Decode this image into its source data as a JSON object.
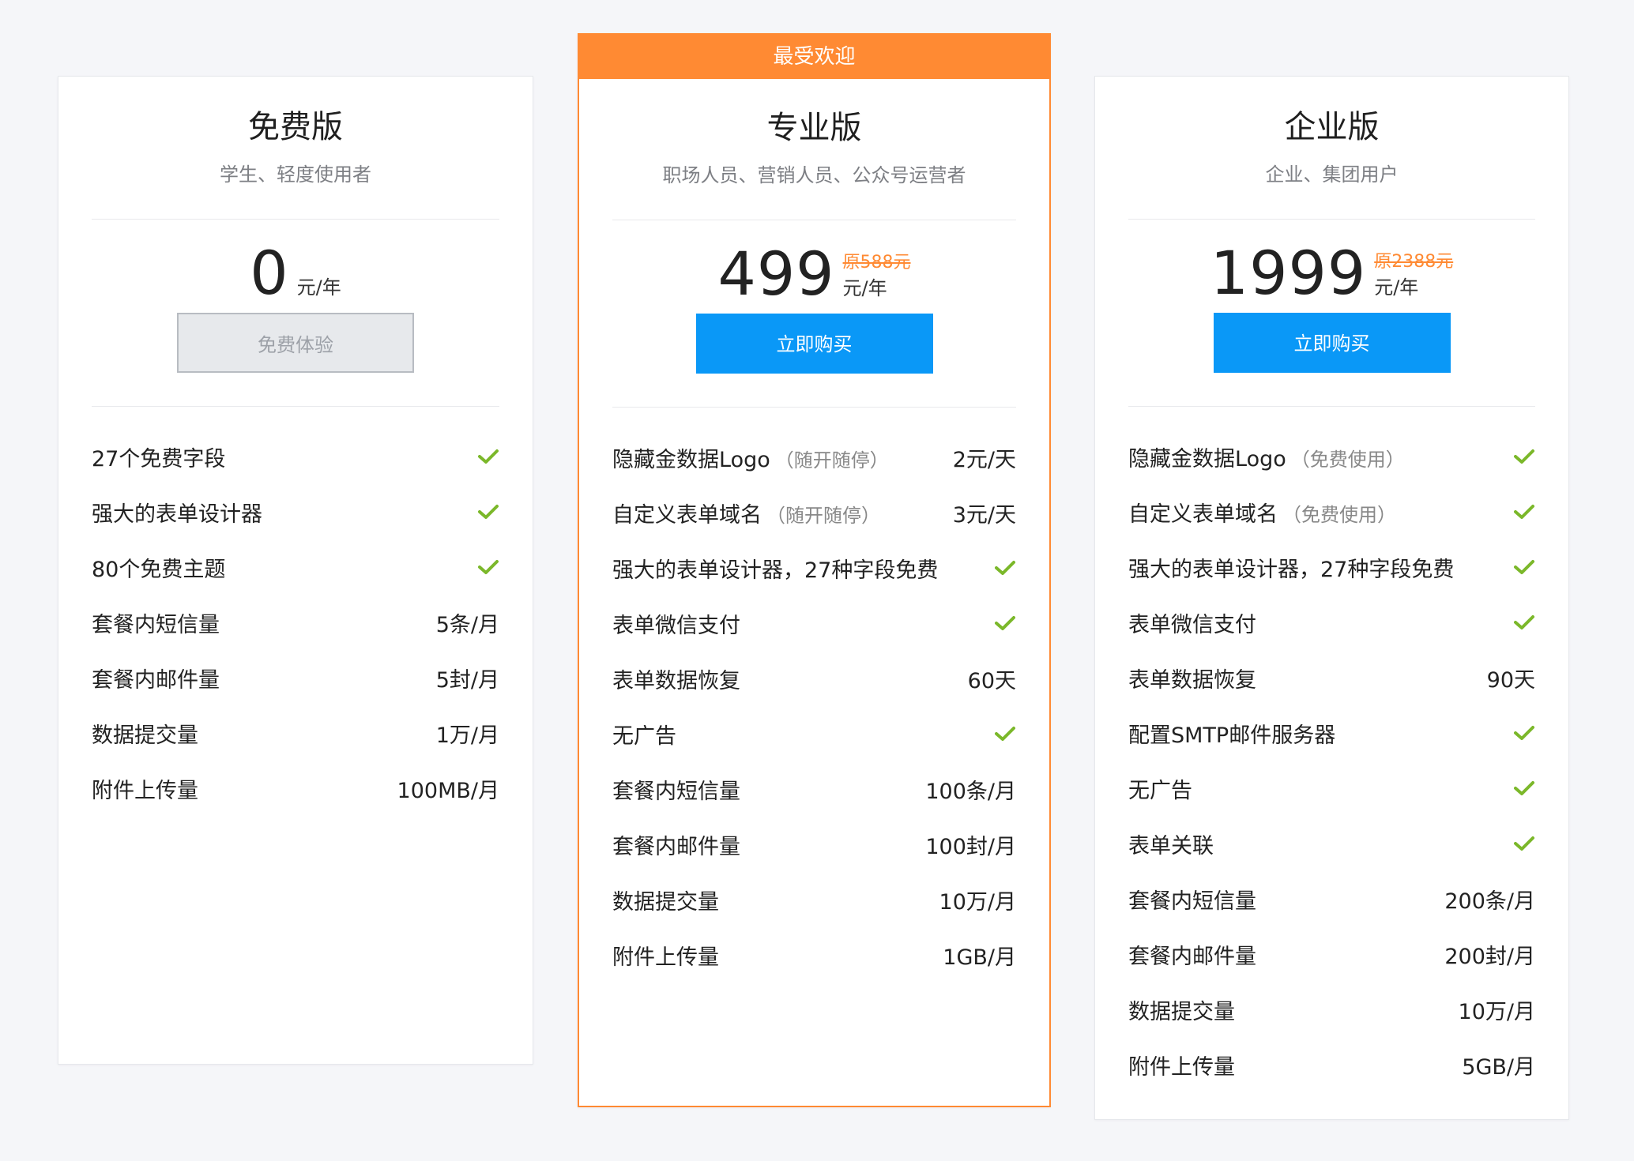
{
  "colors": {
    "accent_orange": "#ff8a33",
    "button_blue": "#0a98f7",
    "check_green": "#7bb82a"
  },
  "plans": [
    {
      "name": "免费版",
      "subtitle": "学生、轻度使用者",
      "price": "0",
      "unit": "元/年",
      "button": "免费体验",
      "features": [
        {
          "label": "27个免费字段",
          "value": "check"
        },
        {
          "label": "强大的表单设计器",
          "value": "check"
        },
        {
          "label": "80个免费主题",
          "value": "check"
        },
        {
          "label": "套餐内短信量",
          "value": "5条/月"
        },
        {
          "label": "套餐内邮件量",
          "value": "5封/月"
        },
        {
          "label": "数据提交量",
          "value": "1万/月"
        },
        {
          "label": "附件上传量",
          "value": "100MB/月"
        }
      ]
    },
    {
      "badge": "最受欢迎",
      "name": "专业版",
      "subtitle": "职场人员、营销人员、公众号运营者",
      "price": "499",
      "original_price": "原588元",
      "unit": "元/年",
      "button": "立即购买",
      "features": [
        {
          "label": "隐藏金数据Logo",
          "note": "（随开随停）",
          "value": "2元/天"
        },
        {
          "label": "自定义表单域名",
          "note": "（随开随停）",
          "value": "3元/天"
        },
        {
          "label": "强大的表单设计器，27种字段免费",
          "value": "check"
        },
        {
          "label": "表单微信支付",
          "value": "check"
        },
        {
          "label": "表单数据恢复",
          "value": "60天"
        },
        {
          "label": "无广告",
          "value": "check"
        },
        {
          "label": "套餐内短信量",
          "value": "100条/月"
        },
        {
          "label": "套餐内邮件量",
          "value": "100封/月"
        },
        {
          "label": "数据提交量",
          "value": "10万/月"
        },
        {
          "label": "附件上传量",
          "value": "1GB/月"
        }
      ]
    },
    {
      "name": "企业版",
      "subtitle": "企业、集团用户",
      "price": "1999",
      "original_price": "原2388元",
      "unit": "元/年",
      "button": "立即购买",
      "features": [
        {
          "label": "隐藏金数据Logo",
          "note": "（免费使用）",
          "value": "check"
        },
        {
          "label": "自定义表单域名",
          "note": "（免费使用）",
          "value": "check"
        },
        {
          "label": "强大的表单设计器，27种字段免费",
          "value": "check"
        },
        {
          "label": "表单微信支付",
          "value": "check"
        },
        {
          "label": "表单数据恢复",
          "value": "90天"
        },
        {
          "label": "配置SMTP邮件服务器",
          "value": "check"
        },
        {
          "label": "无广告",
          "value": "check"
        },
        {
          "label": "表单关联",
          "value": "check"
        },
        {
          "label": "套餐内短信量",
          "value": "200条/月"
        },
        {
          "label": "套餐内邮件量",
          "value": "200封/月"
        },
        {
          "label": "数据提交量",
          "value": "10万/月"
        },
        {
          "label": "附件上传量",
          "value": "5GB/月"
        }
      ]
    }
  ]
}
